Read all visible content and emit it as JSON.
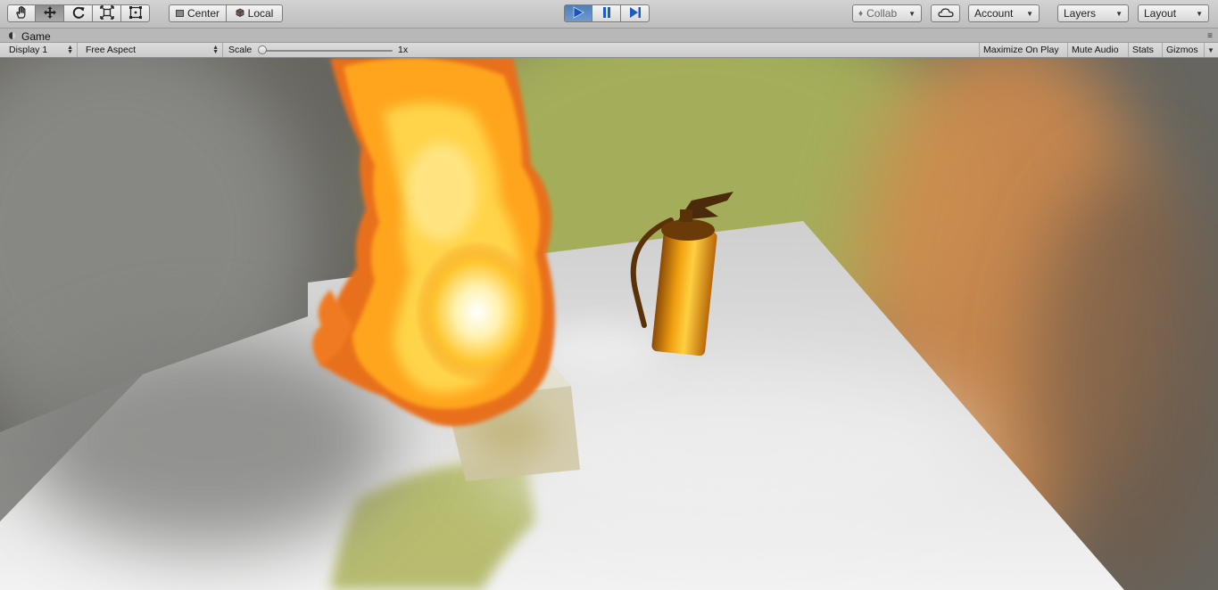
{
  "toolbar": {
    "tools": [
      {
        "name": "hand-tool",
        "icon": "hand-icon",
        "active": false
      },
      {
        "name": "move-tool",
        "icon": "move-arrows-icon",
        "active": true
      },
      {
        "name": "rotate-tool",
        "icon": "rotate-icon",
        "active": false
      },
      {
        "name": "scale-tool",
        "icon": "scale-icon",
        "active": false
      },
      {
        "name": "rect-tool",
        "icon": "rect-transform-icon",
        "active": false
      }
    ],
    "pivot_label": "Center",
    "rotation_label": "Local",
    "play_state": "playing",
    "collab_label": "Collab",
    "account_label": "Account",
    "layers_label": "Layers",
    "layout_label": "Layout"
  },
  "tab": {
    "title": "Game"
  },
  "game_bar": {
    "display": "Display 1",
    "aspect": "Free Aspect",
    "scale_label": "Scale",
    "scale_value": "1x",
    "scale_fraction": 0.0,
    "maximize_on_play": "Maximize On Play",
    "mute_audio": "Mute Audio",
    "stats": "Stats",
    "gizmos": "Gizmos"
  },
  "scene": {
    "description_icons": [
      "fire-effect",
      "smoke-effect",
      "fire-extinguisher",
      "floor-plane",
      "crate-cube"
    ],
    "colors": {
      "fire_core": "#fff6c8",
      "fire_mid": "#ffc020",
      "fire_outer": "#f07010",
      "extinguisher_body": "#e89a10",
      "floor": "#d8d8d8",
      "smoke": "#8a8a86",
      "green_haze": "#a9b45a",
      "orange_haze": "#d98c4a",
      "play_blue": "#5a8cc8"
    }
  }
}
